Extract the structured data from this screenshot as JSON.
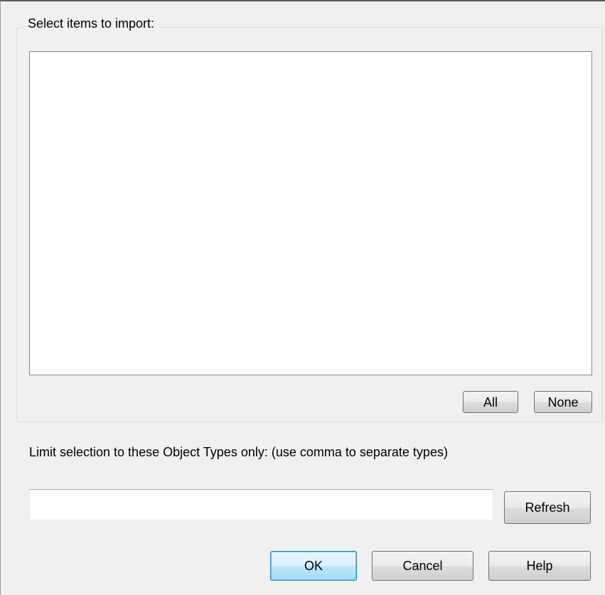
{
  "import_group": {
    "legend": "Select items to import:",
    "items": []
  },
  "buttons": {
    "all": "All",
    "none": "None",
    "refresh": "Refresh",
    "ok": "OK",
    "cancel": "Cancel",
    "help": "Help"
  },
  "object_types": {
    "label": "Limit selection to these Object Types only: (use comma to separate types)",
    "value": "",
    "placeholder": ""
  },
  "colors": {
    "dialog_background": "#f0f0f0",
    "default_button_border": "#3c7fb1",
    "list_background": "#ffffff"
  }
}
